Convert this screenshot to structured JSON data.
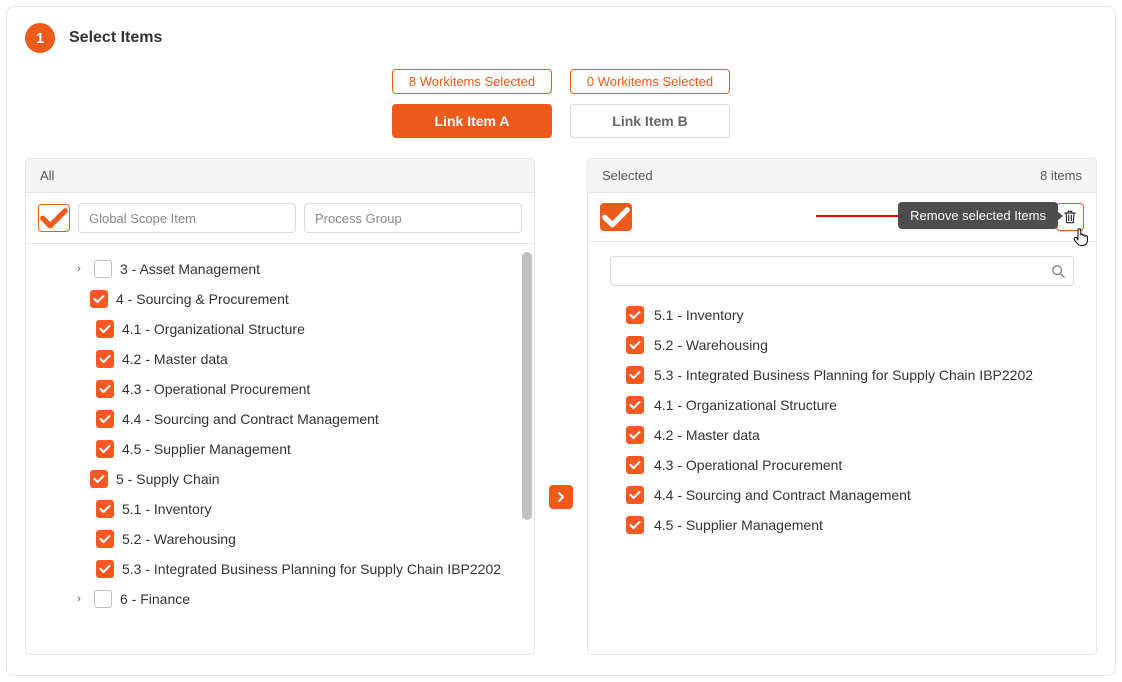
{
  "step": {
    "number": "1",
    "title": "Select Items"
  },
  "badges": {
    "a_count": "8 Workitems Selected",
    "b_count": "0 Workitems Selected"
  },
  "link_buttons": {
    "a": "Link Item A",
    "b": "Link Item B"
  },
  "left": {
    "header": "All",
    "filters": {
      "scope_placeholder": "Global Scope Item",
      "group_placeholder": "Process Group"
    },
    "tree": [
      {
        "label": "3 - Asset Management",
        "level": 0,
        "checked": false,
        "expandable": true
      },
      {
        "label": "4 - Sourcing & Procurement",
        "level": 1,
        "checked": true,
        "expandable": false
      },
      {
        "label": "4.1 - Organizational Structure",
        "level": 2,
        "checked": true,
        "expandable": false
      },
      {
        "label": "4.2 - Master data",
        "level": 2,
        "checked": true,
        "expandable": false
      },
      {
        "label": "4.3 - Operational Procurement",
        "level": 2,
        "checked": true,
        "expandable": false
      },
      {
        "label": "4.4 - Sourcing and Contract Management",
        "level": 2,
        "checked": true,
        "expandable": false
      },
      {
        "label": "4.5 - Supplier Management",
        "level": 2,
        "checked": true,
        "expandable": false
      },
      {
        "label": "5 - Supply Chain",
        "level": 1,
        "checked": true,
        "expandable": false
      },
      {
        "label": "5.1 - Inventory",
        "level": 2,
        "checked": true,
        "expandable": false
      },
      {
        "label": "5.2 - Warehousing",
        "level": 2,
        "checked": true,
        "expandable": false
      },
      {
        "label": "5.3 - Integrated Business Planning for Supply Chain IBP2202",
        "level": 2,
        "checked": true,
        "expandable": false
      },
      {
        "label": "6 - Finance",
        "level": 0,
        "checked": false,
        "expandable": true
      }
    ]
  },
  "right": {
    "header": "Selected",
    "items_count_label": "8 items",
    "tooltip": "Remove selected Items",
    "search_placeholder": "",
    "items": [
      {
        "label": "5.1 - Inventory"
      },
      {
        "label": "5.2 - Warehousing"
      },
      {
        "label": "5.3 - Integrated Business Planning for Supply Chain IBP2202"
      },
      {
        "label": "4.1 - Organizational Structure"
      },
      {
        "label": "4.2 - Master data"
      },
      {
        "label": "4.3 - Operational Procurement"
      },
      {
        "label": "4.4 - Sourcing and Contract Management"
      },
      {
        "label": "4.5 - Supplier Management"
      }
    ]
  }
}
